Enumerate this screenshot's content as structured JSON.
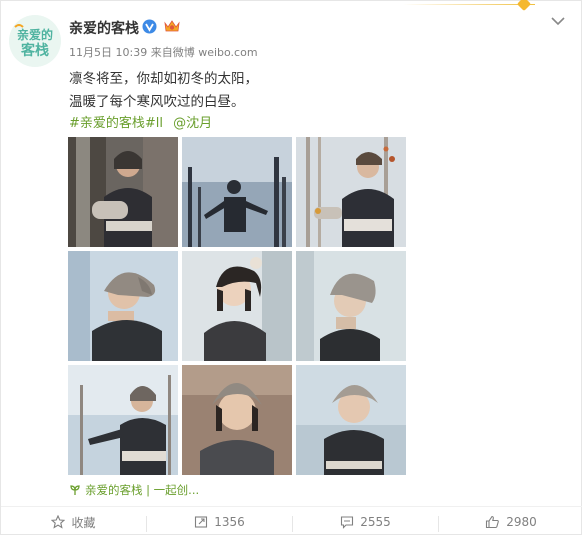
{
  "post": {
    "author": "亲爱的客栈",
    "timestamp": "11月5日 10:39",
    "via": "来自微博 weibo.com",
    "text_line1": "凛冬将至，你却如初冬的太阳，",
    "text_line2": "温暖了每个寒风吹过的白昼。",
    "tag": "#亲爱的客栈#",
    "tag_suffix": "ll",
    "mention": "@沈月",
    "source_label": "亲爱的客栈 | 一起创...",
    "avatar_text_line1": "亲爱的",
    "avatar_text_line2": "客栈"
  },
  "actions": {
    "favorite_label": "收藏",
    "repost_count": "1356",
    "comment_count": "2555",
    "like_count": "2980"
  },
  "icons": {
    "verified": "verified-badge-icon",
    "member": "crown-icon",
    "more": "chevron-down-icon",
    "favorite": "star-icon",
    "repost": "repost-icon",
    "comment": "comment-icon",
    "like": "thumbs-up-icon"
  },
  "colors": {
    "link_green": "#6a9f2d",
    "verified_blue": "#3d8ae6",
    "accent_gold": "#f0c040"
  },
  "photos": [
    "photo-1",
    "photo-2",
    "photo-3",
    "photo-4",
    "photo-5",
    "photo-6",
    "photo-7",
    "photo-8",
    "photo-9"
  ]
}
